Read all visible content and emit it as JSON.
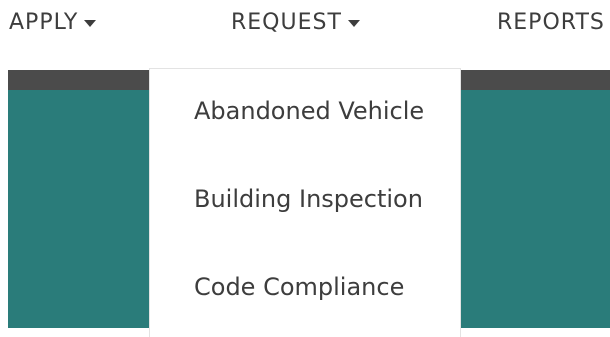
{
  "nav": {
    "apply_label": "APPLY",
    "request_label": "REQUEST",
    "reports_label": "REPORTS"
  },
  "request_menu": {
    "items": [
      {
        "label": "Abandoned Vehicle"
      },
      {
        "label": "Building Inspection"
      },
      {
        "label": "Code Compliance"
      }
    ]
  },
  "colors": {
    "nav_text": "#3d3d3d",
    "band_dark": "#4b4b4b",
    "band_teal": "#2a7c7a",
    "menu_bg": "#ffffff"
  },
  "icons": {
    "dropdown_caret": "caret-down-icon"
  }
}
